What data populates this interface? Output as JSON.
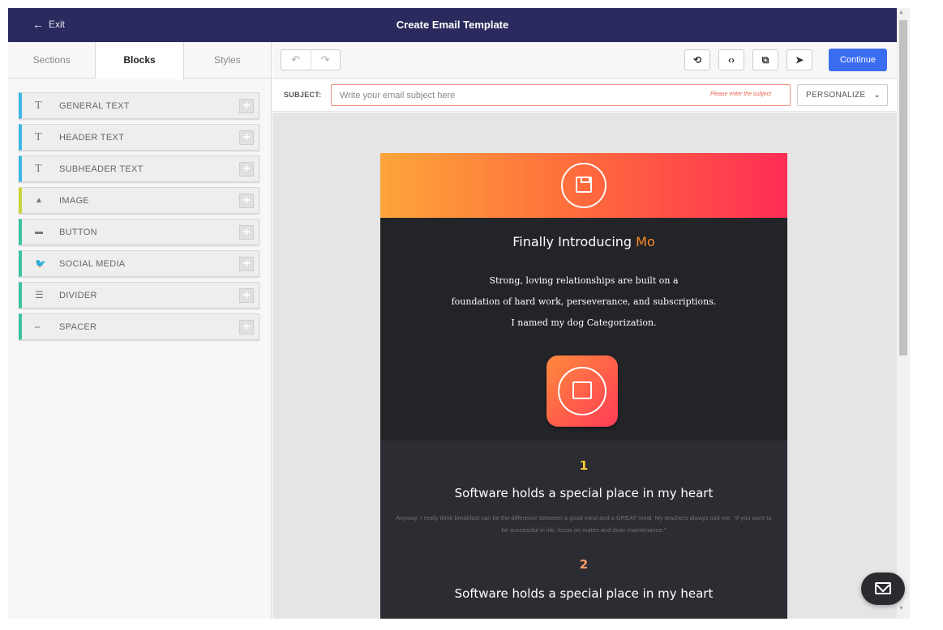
{
  "header": {
    "exit_label": "Exit",
    "title": "Create Email Template"
  },
  "sidebar": {
    "tabs": [
      {
        "label": "Sections",
        "active": false
      },
      {
        "label": "Blocks",
        "active": true
      },
      {
        "label": "Styles",
        "active": false
      }
    ],
    "blocks": [
      {
        "label": "GENERAL TEXT",
        "icon": "text-icon",
        "glyph": "T",
        "accent": "#3fb6e8"
      },
      {
        "label": "HEADER TEXT",
        "icon": "text-icon",
        "glyph": "T",
        "accent": "#3fb6e8"
      },
      {
        "label": "SUBHEADER TEXT",
        "icon": "text-icon",
        "glyph": "T",
        "accent": "#3fb6e8"
      },
      {
        "label": "IMAGE",
        "icon": "image-icon",
        "glyph": "▲",
        "accent": "#c9d53a"
      },
      {
        "label": "BUTTON",
        "icon": "button-icon",
        "glyph": "▬",
        "accent": "#3cc3a0"
      },
      {
        "label": "SOCIAL MEDIA",
        "icon": "twitter-icon",
        "glyph": "🐦",
        "accent": "#3cc3a0"
      },
      {
        "label": "DIVIDER",
        "icon": "divider-icon",
        "glyph": "☰",
        "accent": "#3cc3a0"
      },
      {
        "label": "SPACER",
        "icon": "spacer-icon",
        "glyph": "⎯",
        "accent": "#3cc3a0"
      }
    ]
  },
  "toolbar": {
    "undo_icon": "↶",
    "redo_icon": "↷",
    "history_icon": "⟲",
    "code_icon": "‹›",
    "preview_icon": "⧉",
    "send_icon": "➤",
    "continue_label": "Continue"
  },
  "subject": {
    "label": "SUBJECT:",
    "placeholder": "Write your email subject here",
    "error": "Please enter the subject",
    "personalize_label": "PERSONALIZE"
  },
  "email": {
    "headline_prefix": "Finally Introducing ",
    "headline_accent": "Mo",
    "body_lines": [
      "Strong, loving relationships are built on a",
      "foundation of hard work, perseverance, and subscriptions.",
      "I named my dog Categorization."
    ],
    "items": [
      {
        "number": "1",
        "title": "Software holds a special place in my heart",
        "body": "Anyway, I really think breakfast can be the difference between a good meal and a GREAT meal. My teachers always told me, \"If you want to be successful in life, focus on mates and diver maintenance.\""
      },
      {
        "number": "2",
        "title": "Software holds a special place in my heart"
      }
    ]
  },
  "colors": {
    "topbar": "#2b2a5e",
    "primary": "#3b6df0",
    "accent_orange": "#ff8a2b",
    "error": "#e8604c"
  }
}
